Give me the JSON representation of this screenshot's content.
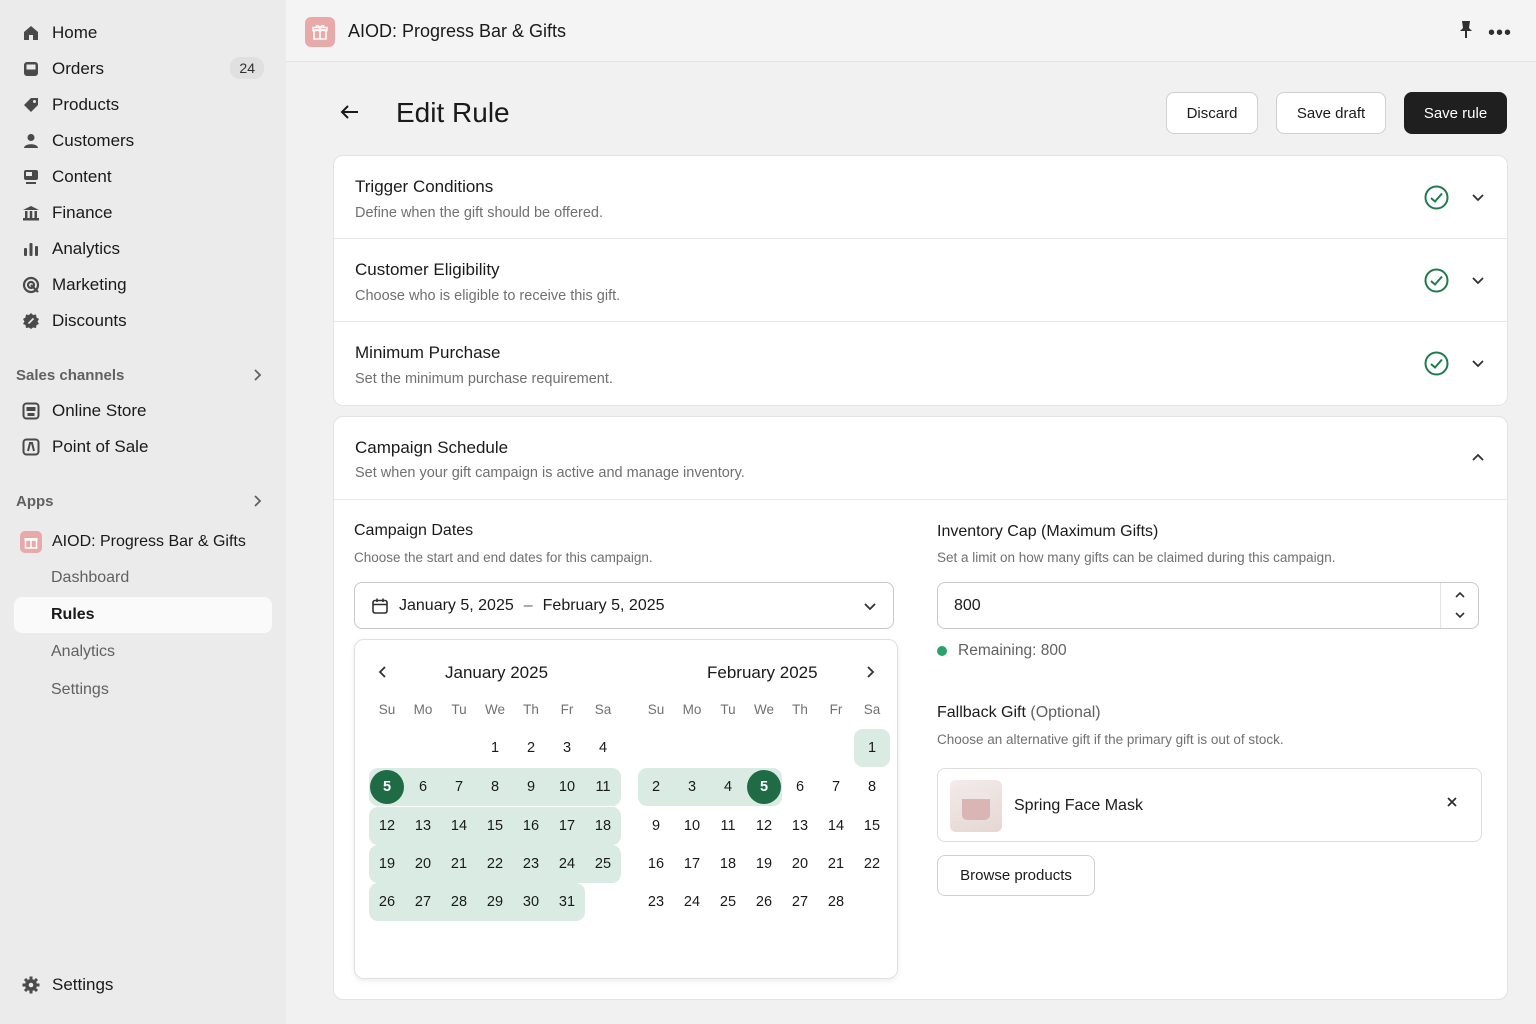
{
  "sidebar": {
    "nav": [
      {
        "label": "Home",
        "icon": "home-icon"
      },
      {
        "label": "Orders",
        "icon": "inbox-icon",
        "badge": "24"
      },
      {
        "label": "Products",
        "icon": "tag-icon"
      },
      {
        "label": "Customers",
        "icon": "person-icon"
      },
      {
        "label": "Content",
        "icon": "content-icon"
      },
      {
        "label": "Finance",
        "icon": "bank-icon"
      },
      {
        "label": "Analytics",
        "icon": "bar-chart-icon"
      },
      {
        "label": "Marketing",
        "icon": "target-icon"
      },
      {
        "label": "Discounts",
        "icon": "discount-icon"
      }
    ],
    "sales_channels_label": "Sales channels",
    "channels": [
      {
        "label": "Online Store",
        "icon": "store-icon"
      },
      {
        "label": "Point of Sale",
        "icon": "pos-icon"
      }
    ],
    "apps_label": "Apps",
    "app_name": "AIOD: Progress Bar & Gifts",
    "app_sub": [
      {
        "label": "Dashboard",
        "active": false
      },
      {
        "label": "Rules",
        "active": true
      },
      {
        "label": "Analytics",
        "active": false
      },
      {
        "label": "Settings",
        "active": false
      }
    ],
    "settings_label": "Settings"
  },
  "topbar": {
    "title": "AIOD: Progress Bar & Gifts"
  },
  "header": {
    "title": "Edit Rule",
    "discard": "Discard",
    "save_draft": "Save draft",
    "save_rule": "Save rule"
  },
  "sections": [
    {
      "title": "Trigger Conditions",
      "subtitle": "Define when the gift should be offered.",
      "complete": true
    },
    {
      "title": "Customer Eligibility",
      "subtitle": "Choose who is eligible to receive this gift.",
      "complete": true
    },
    {
      "title": "Minimum Purchase",
      "subtitle": "Set the minimum purchase requirement.",
      "complete": true
    }
  ],
  "schedule": {
    "title": "Campaign Schedule",
    "subtitle": "Set when your gift campaign is active and manage inventory.",
    "dates_label": "Campaign Dates",
    "dates_help": "Choose the start and end dates for this campaign.",
    "start_date": "January 5, 2025",
    "separator": "–",
    "end_date": "February 5, 2025",
    "calendar": {
      "weekdays": [
        "Su",
        "Mo",
        "Tu",
        "We",
        "Th",
        "Fr",
        "Sa"
      ],
      "months": [
        {
          "title": "January 2025",
          "first_weekday": 3,
          "days": 31,
          "selected_from": 5,
          "selected_to": 31,
          "selected_day": 5
        },
        {
          "title": "February 2025",
          "first_weekday": 6,
          "days": 28,
          "selected_from": 1,
          "selected_to": 5,
          "selected_day": 5
        }
      ]
    },
    "inventory_label": "Inventory Cap (Maximum Gifts)",
    "inventory_help": "Set a limit on how many gifts can be claimed during this campaign.",
    "inventory_value": "800",
    "remaining": "Remaining: 800",
    "fallback_label": "Fallback Gift",
    "fallback_optional": "(Optional)",
    "fallback_help": "Choose an alternative gift if the primary gift is out of stock.",
    "fallback_product": "Spring Face Mask",
    "browse": "Browse products"
  },
  "colors": {
    "accent": "#1f6b46",
    "range": "#d9ebe2",
    "check": "#1f7a4d",
    "app_logo": "#e8a9a9"
  }
}
